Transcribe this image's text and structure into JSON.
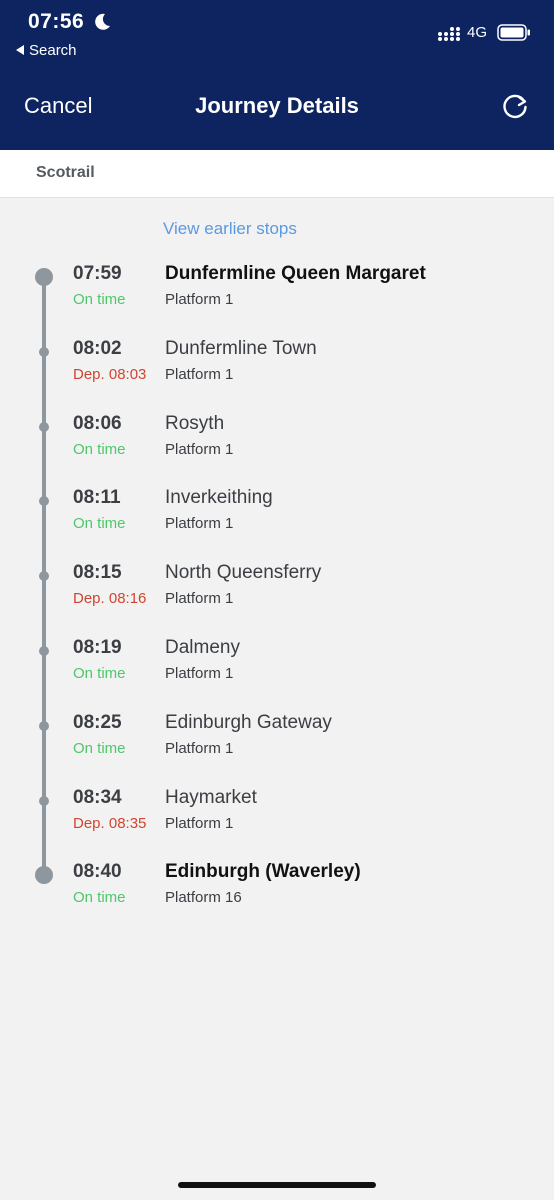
{
  "status_bar": {
    "time": "07:56",
    "back_label": "Search",
    "network": "4G"
  },
  "nav": {
    "cancel": "Cancel",
    "title": "Journey Details"
  },
  "operator": "Scotrail",
  "view_earlier": "View earlier stops",
  "colors": {
    "header_bg": "#0d2461",
    "on_time": "#4fc76a",
    "late": "#d0452f",
    "link": "#5a9ae2",
    "timeline": "#8f979e"
  },
  "stops": [
    {
      "time": "07:59",
      "status": "On time",
      "station": "Dunfermline Queen Margaret",
      "platform": "Platform 1"
    },
    {
      "time": "08:02",
      "status": "Dep. 08:03",
      "station": "Dunfermline Town",
      "platform": "Platform 1"
    },
    {
      "time": "08:06",
      "status": "On time",
      "station": "Rosyth",
      "platform": "Platform 1"
    },
    {
      "time": "08:11",
      "status": "On time",
      "station": "Inverkeithing",
      "platform": "Platform 1"
    },
    {
      "time": "08:15",
      "status": "Dep. 08:16",
      "station": "North Queensferry",
      "platform": "Platform 1"
    },
    {
      "time": "08:19",
      "status": "On time",
      "station": "Dalmeny",
      "platform": "Platform 1"
    },
    {
      "time": "08:25",
      "status": "On time",
      "station": "Edinburgh Gateway",
      "platform": "Platform 1"
    },
    {
      "time": "08:34",
      "status": "Dep. 08:35",
      "station": "Haymarket",
      "platform": "Platform 1"
    },
    {
      "time": "08:40",
      "status": "On time",
      "station": "Edinburgh (Waverley)",
      "platform": "Platform 16"
    }
  ]
}
